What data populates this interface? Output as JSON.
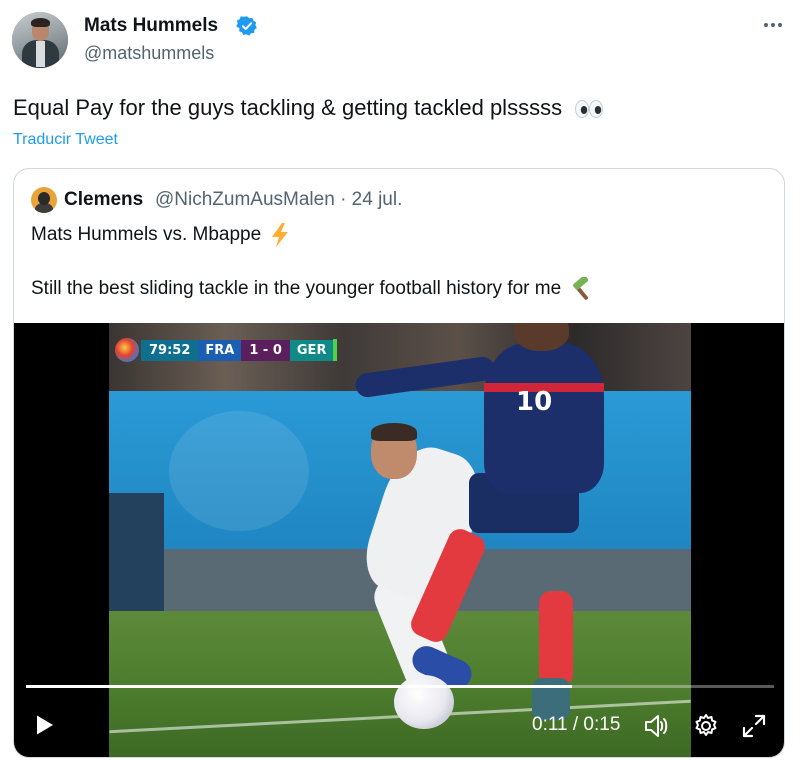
{
  "tweet": {
    "author_name": "Mats Hummels",
    "author_handle": "@matshummels",
    "text": "Equal Pay for the guys tackling & getting tackled plsssss",
    "translate_label": "Traducir Tweet",
    "accent_color": "#1d9bf0"
  },
  "quoted": {
    "author_name": "Clemens",
    "meta": "@NichZumAusMalen · 24 jul.",
    "line1": "Mats Hummels vs. Mbappe",
    "line2": "Still the best sliding tackle in the younger football history for me"
  },
  "video": {
    "scorebug": {
      "clock": "79:52",
      "team_home": "FRA",
      "score": "1 - 0",
      "team_away": "GER"
    },
    "jersey_number": "10",
    "time_display": "0:11 / 0:15",
    "progress": 0.73
  },
  "icons": [
    "verified-badge-icon",
    "more-options-icon",
    "eyes-emoji",
    "lightning-emoji",
    "hammer-emoji",
    "play-icon",
    "volume-icon",
    "settings-gear-icon",
    "fullscreen-icon"
  ]
}
